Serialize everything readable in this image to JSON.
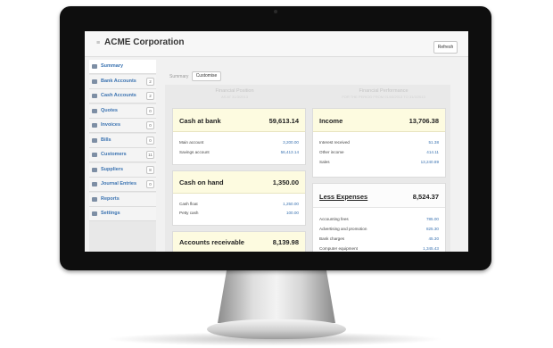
{
  "app": {
    "title": "ACME Corporation",
    "refresh_label": "Refresh"
  },
  "sidebar": {
    "items": [
      {
        "label": "Summary",
        "count": ""
      },
      {
        "label": "Bank Accounts",
        "count": "2"
      },
      {
        "label": "Cash Accounts",
        "count": "2"
      },
      {
        "label": "Quotes",
        "count": "0"
      },
      {
        "label": "Invoices",
        "count": "0"
      },
      {
        "label": "Bills",
        "count": "0"
      },
      {
        "label": "Customers",
        "count": "11"
      },
      {
        "label": "Suppliers",
        "count": "8"
      },
      {
        "label": "Journal Entries",
        "count": "0"
      },
      {
        "label": "Reports",
        "count": ""
      },
      {
        "label": "Settings",
        "count": ""
      }
    ]
  },
  "tabs": {
    "summary": "Summary",
    "customise": "Customise"
  },
  "sections": {
    "financial_position": {
      "title": "Financial Position",
      "subtitle": "AS AT 31/3/2013"
    },
    "financial_performance": {
      "title": "Financial Performance",
      "subtitle": "FOR THE PERIOD FROM 01/03/2013 TO 31/3/2013"
    }
  },
  "cards": {
    "cash_at_bank": {
      "title": "Cash at bank",
      "total": "59,613.14",
      "rows": [
        {
          "label": "Main account",
          "value": "3,200.00"
        },
        {
          "label": "Savings account",
          "value": "56,413.14"
        }
      ]
    },
    "cash_on_hand": {
      "title": "Cash on hand",
      "total": "1,350.00",
      "rows": [
        {
          "label": "Cash float",
          "value": "1,250.00"
        },
        {
          "label": "Petty cash",
          "value": "100.00"
        }
      ]
    },
    "accounts_receivable": {
      "title": "Accounts receivable",
      "total": "8,139.98"
    },
    "income": {
      "title": "Income",
      "total": "13,706.38",
      "rows": [
        {
          "label": "Interest received",
          "value": "51.38"
        },
        {
          "label": "Other income",
          "value": "414.11"
        },
        {
          "label": "Sales",
          "value": "13,240.89"
        }
      ]
    },
    "less_expenses": {
      "title": "Less Expenses",
      "total": "8,524.37",
      "rows": [
        {
          "label": "Accounting fees",
          "value": "785.00"
        },
        {
          "label": "Advertising and promotion",
          "value": "825.30"
        },
        {
          "label": "Bank charges",
          "value": "45.30"
        },
        {
          "label": "Computer equipment",
          "value": "1,345.43"
        }
      ]
    }
  }
}
